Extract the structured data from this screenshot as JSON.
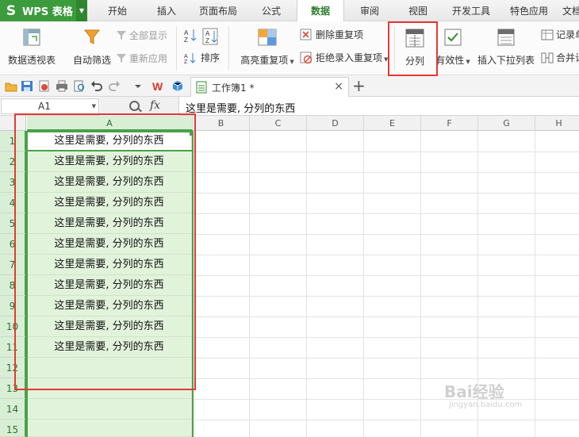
{
  "app": {
    "title": "WPS 表格",
    "logo_glyph": "S",
    "brand_color": "#3c9b3c"
  },
  "menu": {
    "tabs": [
      "开始",
      "插入",
      "页面布局",
      "公式",
      "数据",
      "审阅",
      "视图",
      "开发工具",
      "特色应用",
      "文档"
    ],
    "active": "数据"
  },
  "ribbon": {
    "pivot": "数据透视表",
    "autofilter": "自动筛选",
    "show_all": "全部显示",
    "reapply": "重新应用",
    "sort": "排序",
    "highlight_dup": "高亮重复项",
    "remove_dup": "删除重复项",
    "reject_dup": "拒绝录入重复项",
    "split": "分列",
    "validity": "有效性",
    "insert_dropdown": "插入下拉列表",
    "record": "记录单",
    "merge": "合并计"
  },
  "doc_tab": {
    "name": "工作簿1 *",
    "close": "×",
    "new": "+"
  },
  "formula_bar": {
    "cell_ref": "A1",
    "fx": "fx",
    "content": "这里是需要, 分列的东西"
  },
  "grid": {
    "columns": [
      "A",
      "B",
      "C",
      "D",
      "E",
      "F",
      "G",
      "H"
    ],
    "rows": [
      "1",
      "2",
      "3",
      "4",
      "5",
      "6",
      "7",
      "8",
      "9",
      "10",
      "11",
      "12",
      "13",
      "14",
      "15"
    ],
    "colA": [
      "这里是需要, 分列的东西",
      "这里是需要, 分列的东西",
      "这里是需要, 分列的东西",
      "这里是需要, 分列的东西",
      "这里是需要, 分列的东西",
      "这里是需要, 分列的东西",
      "这里是需要, 分列的东西",
      "这里是需要, 分列的东西",
      "这里是需要, 分列的东西",
      "这里是需要, 分列的东西",
      "这里是需要, 分列的东西",
      "",
      "",
      "",
      ""
    ]
  },
  "annotation_color": "#e53935",
  "watermark": {
    "brand": "Bai经验",
    "url": "jingyan.baidu.com"
  }
}
